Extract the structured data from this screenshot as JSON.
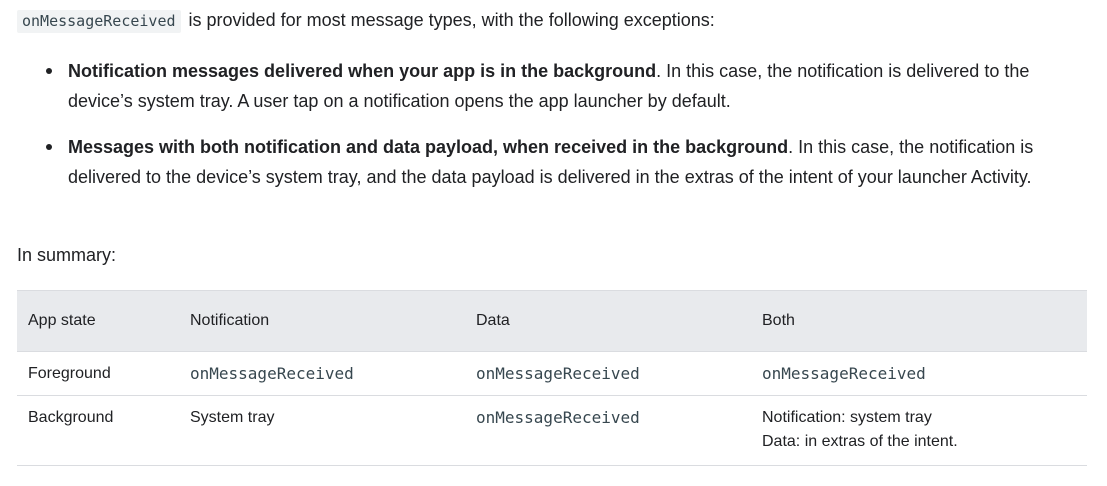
{
  "intro": {
    "code": "onMessageReceived",
    "text": " is provided for most message types, with the following exceptions:"
  },
  "exceptions": [
    {
      "bold": "Notification messages delivered when your app is in the background",
      "text": ". In this case, the notification is delivered to the device’s system tray. A user tap on a notification opens the app launcher by default."
    },
    {
      "bold": "Messages with both notification and data payload, when received in the background",
      "text": ". In this case, the notification is delivered to the device’s system tray, and the data payload is delivered in the extras of the intent of your launcher Activity."
    }
  ],
  "summary_label": "In summary:",
  "table": {
    "headers": [
      "App state",
      "Notification",
      "Data",
      "Both"
    ],
    "rows": [
      {
        "app_state": "Foreground",
        "notification": "onMessageReceived",
        "data": "onMessageReceived",
        "both": [
          "onMessageReceived"
        ]
      },
      {
        "app_state": "Background",
        "notification": "System tray",
        "data": "onMessageReceived",
        "both": [
          "Notification: system tray",
          "Data: in extras of the intent."
        ]
      }
    ]
  },
  "colors": {
    "text": "#202124",
    "code_background": "#f1f3f4",
    "code_text": "#37474f",
    "table_header_background": "#e8eaed",
    "table_border": "#dadce0"
  }
}
